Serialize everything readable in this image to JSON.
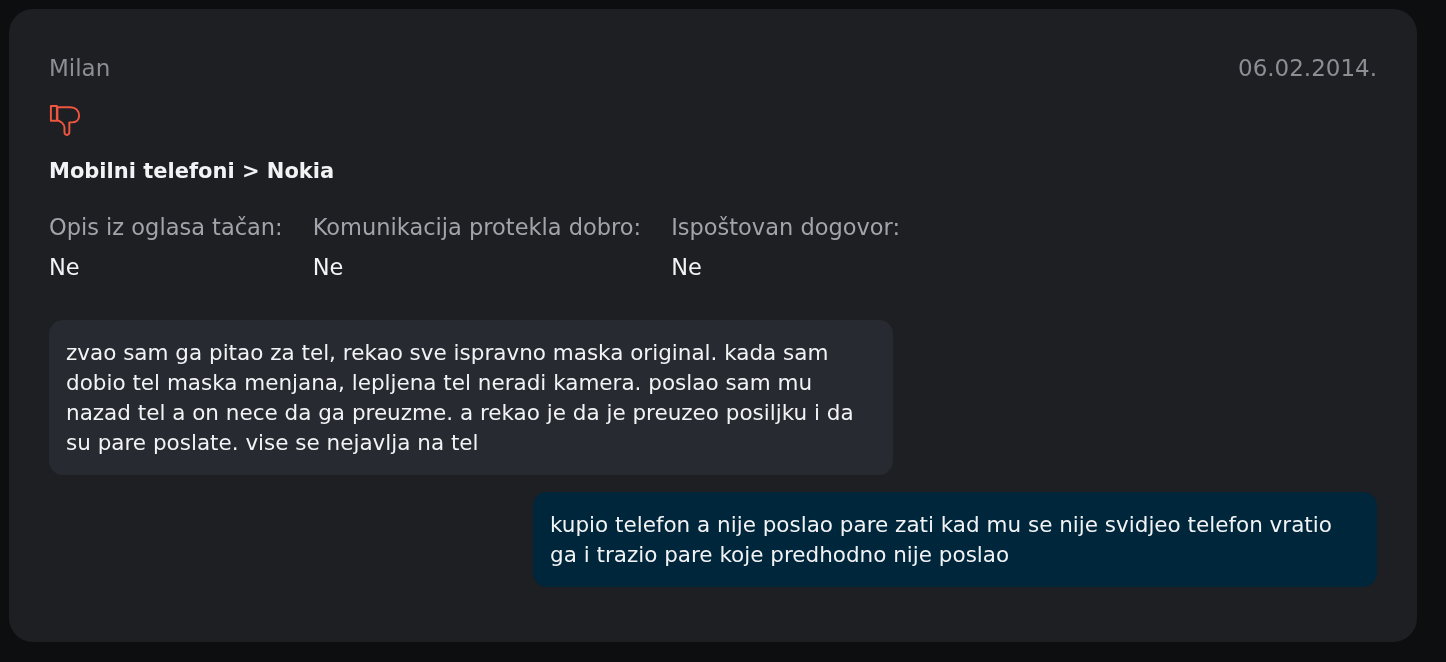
{
  "review": {
    "author": "Milan",
    "date": "06.02.2014.",
    "positive": false,
    "category": "Mobilni telefoni > Nokia",
    "ratings": [
      {
        "label": "Opis iz oglasa tačan:",
        "value": "Ne"
      },
      {
        "label": "Komunikacija protekla dobro:",
        "value": "Ne"
      },
      {
        "label": "Ispoštovan dogovor:",
        "value": "Ne"
      }
    ],
    "messages": [
      {
        "kind": "comment",
        "text": "zvao sam ga pitao za tel, rekao sve ispravno maska original. kada sam dobio tel maska menjana, lepljena tel neradi kamera. poslao sam mu nazad tel a on nece da ga preuzme. a rekao je da je preuzeo posiljku i da su pare poslate. vise se nejavlja na tel"
      },
      {
        "kind": "reply",
        "text": "kupio telefon a nije poslao pare zati kad mu se nije svidjeo telefon vratio ga i trazio pare koje predhodno nije poslao"
      }
    ]
  }
}
